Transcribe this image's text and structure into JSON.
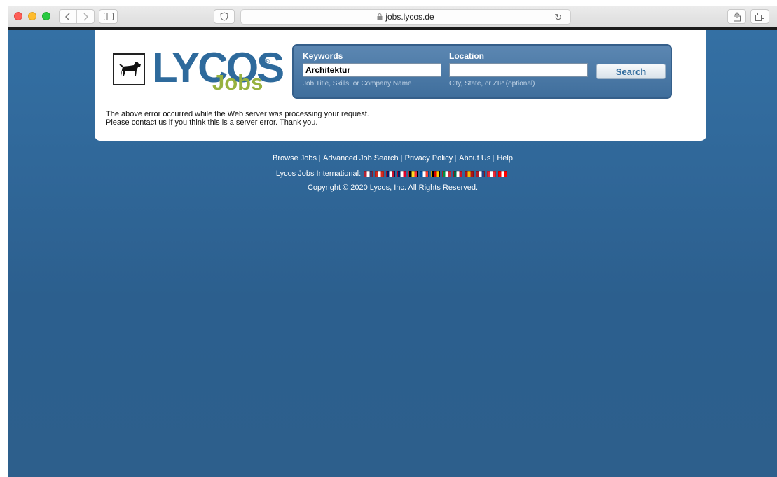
{
  "browser": {
    "url": "jobs.lycos.de"
  },
  "logo": {
    "brand": "LYCOS",
    "sub": "Jobs",
    "registered": "®"
  },
  "search": {
    "keywords_label": "Keywords",
    "keywords_value": "Architektur",
    "keywords_hint": "Job Title, Skills, or Company Name",
    "location_label": "Location",
    "location_value": "",
    "location_hint": "City, State, or ZIP (optional)",
    "button_label": "Search"
  },
  "error": {
    "line1": "The above error occurred while the Web server was processing your request.",
    "line2": "Please contact us if you think this is a server error. Thank you."
  },
  "footer": {
    "links": [
      "Browse Jobs",
      "Advanced Job Search",
      "Privacy Policy",
      "About Us",
      "Help"
    ],
    "intl_label": "Lycos Jobs International:",
    "flags": [
      {
        "name": "us-flag-icon",
        "colors": [
          "#b22234",
          "#ffffff",
          "#3c3b6e"
        ]
      },
      {
        "name": "canada-flag-icon",
        "colors": [
          "#d52b1e",
          "#ffffff",
          "#d52b1e"
        ]
      },
      {
        "name": "uk-flag-icon",
        "colors": [
          "#012169",
          "#ffffff",
          "#c8102e"
        ]
      },
      {
        "name": "australia-flag-icon",
        "colors": [
          "#012169",
          "#ffffff",
          "#e4002b"
        ]
      },
      {
        "name": "belgium-flag-icon",
        "colors": [
          "#000000",
          "#fdda24",
          "#ef3340"
        ]
      },
      {
        "name": "france-flag-icon",
        "colors": [
          "#0055a4",
          "#ffffff",
          "#ef4135"
        ]
      },
      {
        "name": "germany-flag-icon",
        "colors": [
          "#000000",
          "#dd0000",
          "#ffce00"
        ]
      },
      {
        "name": "italy-flag-icon",
        "colors": [
          "#009246",
          "#ffffff",
          "#ce2b37"
        ]
      },
      {
        "name": "mexico-flag-icon",
        "colors": [
          "#006847",
          "#ffffff",
          "#ce1126"
        ]
      },
      {
        "name": "spain-flag-icon",
        "colors": [
          "#aa151b",
          "#f1bf00",
          "#aa151b"
        ]
      },
      {
        "name": "netherlands-flag-icon",
        "colors": [
          "#ae1c28",
          "#ffffff",
          "#21468b"
        ]
      },
      {
        "name": "austria-flag-icon",
        "colors": [
          "#ed2939",
          "#ffffff",
          "#ed2939"
        ]
      },
      {
        "name": "switzerland-flag-icon",
        "colors": [
          "#ff0000",
          "#ffffff",
          "#ff0000"
        ]
      }
    ],
    "copyright": "Copyright © 2020 Lycos, Inc. All Rights Reserved."
  }
}
